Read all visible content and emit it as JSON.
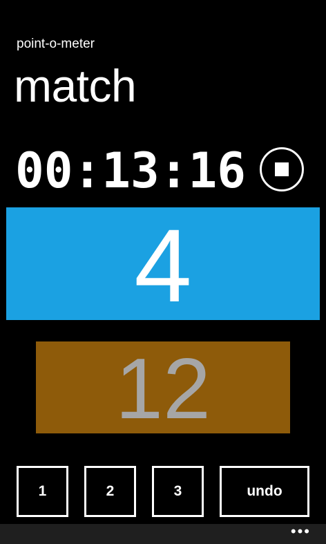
{
  "header": {
    "app_title": "point-o-meter",
    "page_title": "match"
  },
  "timer": {
    "display": "00:13:16",
    "stop_icon": "stop-icon"
  },
  "scores": {
    "home": {
      "value": "4",
      "color": "#1BA1E2"
    },
    "away": {
      "value": "12",
      "color": "#8E5B0A",
      "text_color": "#A6A6A6"
    }
  },
  "buttons": {
    "one": "1",
    "two": "2",
    "three": "3",
    "undo": "undo"
  },
  "app_bar": {
    "more_icon": "ellipsis-icon",
    "more_label": "•••"
  }
}
